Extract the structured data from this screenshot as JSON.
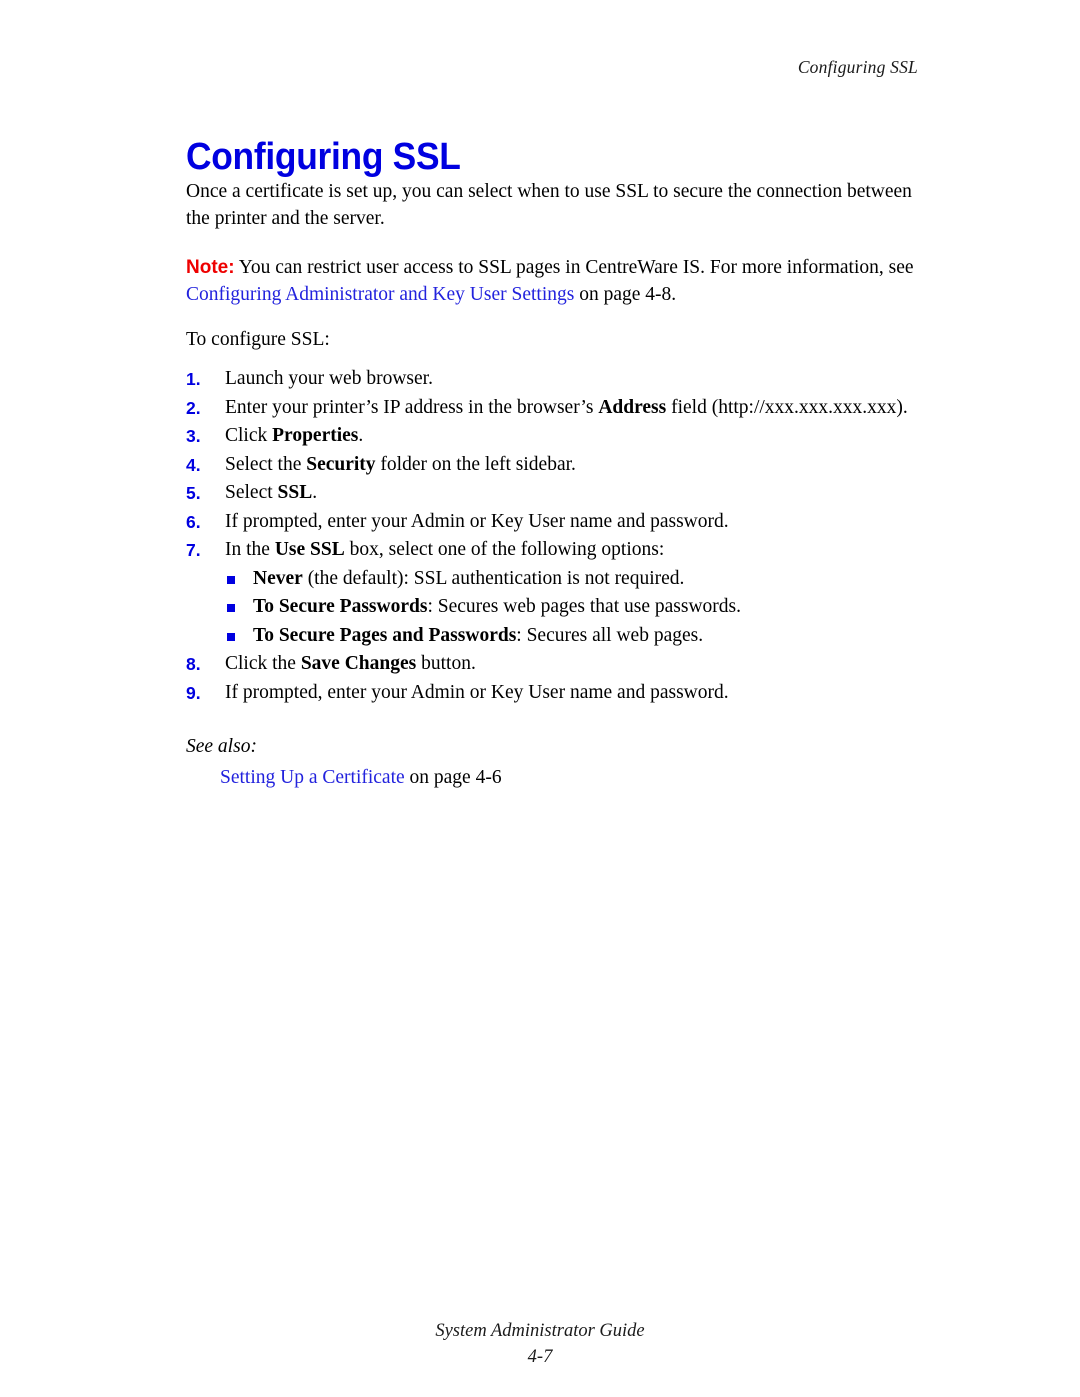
{
  "header": {
    "running_title": "Configuring SSL"
  },
  "heading": {
    "title": "Configuring SSL",
    "color": "#0000E0"
  },
  "intro": {
    "text": "Once a certificate is set up, you can select when to use SSL to secure the connection between the printer and the server."
  },
  "note": {
    "label": "Note:",
    "label_color": "#EE0000",
    "text_before_link": " You can restrict user access to SSL pages in CentreWare IS. For more information, see ",
    "link_text": "Configuring Administrator and Key User Settings",
    "text_after_link": " on page 4-8."
  },
  "lead_in": {
    "text": "To configure SSL:"
  },
  "steps": [
    {
      "number": "1.",
      "segments": [
        {
          "text": "Launch your web browser.",
          "bold": false
        }
      ]
    },
    {
      "number": "2.",
      "segments": [
        {
          "text": "Enter your printer’s IP address in the browser’s ",
          "bold": false
        },
        {
          "text": "Address",
          "bold": true
        },
        {
          "text": " field (http://xxx.xxx.xxx.xxx).",
          "bold": false
        }
      ]
    },
    {
      "number": "3.",
      "segments": [
        {
          "text": "Click ",
          "bold": false
        },
        {
          "text": "Properties",
          "bold": true
        },
        {
          "text": ".",
          "bold": false
        }
      ]
    },
    {
      "number": "4.",
      "segments": [
        {
          "text": "Select the ",
          "bold": false
        },
        {
          "text": "Security",
          "bold": true
        },
        {
          "text": " folder on the left sidebar.",
          "bold": false
        }
      ]
    },
    {
      "number": "5.",
      "segments": [
        {
          "text": "Select ",
          "bold": false
        },
        {
          "text": "SSL",
          "bold": true
        },
        {
          "text": ".",
          "bold": false
        }
      ]
    },
    {
      "number": "6.",
      "segments": [
        {
          "text": "If prompted, enter your Admin or Key User name and password.",
          "bold": false
        }
      ]
    },
    {
      "number": "7.",
      "segments": [
        {
          "text": "In the ",
          "bold": false
        },
        {
          "text": "Use SSL",
          "bold": true
        },
        {
          "text": " box, select one of the following options:",
          "bold": false
        }
      ]
    }
  ],
  "bullets": {
    "marker_color": "#0000E0",
    "items": [
      {
        "segments": [
          {
            "text": "Never",
            "bold": true
          },
          {
            "text": " (the default): SSL authentication is not required.",
            "bold": false
          }
        ]
      },
      {
        "segments": [
          {
            "text": "To Secure Passwords",
            "bold": true
          },
          {
            "text": ": Secures web pages that use passwords.",
            "bold": false
          }
        ]
      },
      {
        "segments": [
          {
            "text": "To Secure Pages and Passwords",
            "bold": true
          },
          {
            "text": ": Secures all web pages.",
            "bold": false
          }
        ]
      }
    ]
  },
  "steps_after_bullets": [
    {
      "number": "8.",
      "segments": [
        {
          "text": "Click the ",
          "bold": false
        },
        {
          "text": "Save Changes",
          "bold": true
        },
        {
          "text": " button.",
          "bold": false
        }
      ]
    },
    {
      "number": "9.",
      "segments": [
        {
          "text": "If prompted, enter your Admin or Key User name and password.",
          "bold": false
        }
      ]
    }
  ],
  "see_also": {
    "heading": "See also:",
    "link_text": "Setting Up a Certificate",
    "suffix": " on page 4-6",
    "link_color": "#2222DD"
  },
  "footer": {
    "guide_title": "System Administrator Guide",
    "page_number": "4-7"
  }
}
